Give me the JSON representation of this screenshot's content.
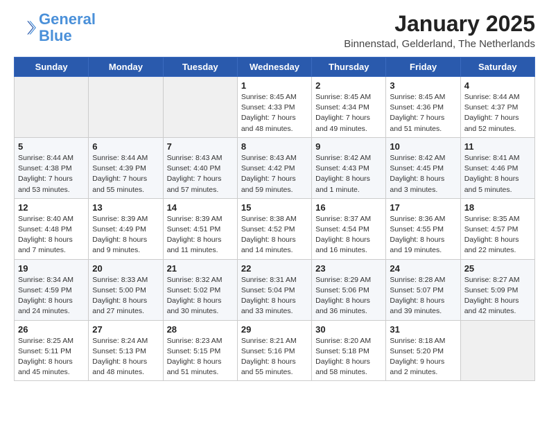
{
  "header": {
    "logo_line1": "General",
    "logo_line2": "Blue",
    "month": "January 2025",
    "location": "Binnenstad, Gelderland, The Netherlands"
  },
  "days_of_week": [
    "Sunday",
    "Monday",
    "Tuesday",
    "Wednesday",
    "Thursday",
    "Friday",
    "Saturday"
  ],
  "weeks": [
    [
      {
        "day": "",
        "info": ""
      },
      {
        "day": "",
        "info": ""
      },
      {
        "day": "",
        "info": ""
      },
      {
        "day": "1",
        "info": "Sunrise: 8:45 AM\nSunset: 4:33 PM\nDaylight: 7 hours\nand 48 minutes."
      },
      {
        "day": "2",
        "info": "Sunrise: 8:45 AM\nSunset: 4:34 PM\nDaylight: 7 hours\nand 49 minutes."
      },
      {
        "day": "3",
        "info": "Sunrise: 8:45 AM\nSunset: 4:36 PM\nDaylight: 7 hours\nand 51 minutes."
      },
      {
        "day": "4",
        "info": "Sunrise: 8:44 AM\nSunset: 4:37 PM\nDaylight: 7 hours\nand 52 minutes."
      }
    ],
    [
      {
        "day": "5",
        "info": "Sunrise: 8:44 AM\nSunset: 4:38 PM\nDaylight: 7 hours\nand 53 minutes."
      },
      {
        "day": "6",
        "info": "Sunrise: 8:44 AM\nSunset: 4:39 PM\nDaylight: 7 hours\nand 55 minutes."
      },
      {
        "day": "7",
        "info": "Sunrise: 8:43 AM\nSunset: 4:40 PM\nDaylight: 7 hours\nand 57 minutes."
      },
      {
        "day": "8",
        "info": "Sunrise: 8:43 AM\nSunset: 4:42 PM\nDaylight: 7 hours\nand 59 minutes."
      },
      {
        "day": "9",
        "info": "Sunrise: 8:42 AM\nSunset: 4:43 PM\nDaylight: 8 hours\nand 1 minute."
      },
      {
        "day": "10",
        "info": "Sunrise: 8:42 AM\nSunset: 4:45 PM\nDaylight: 8 hours\nand 3 minutes."
      },
      {
        "day": "11",
        "info": "Sunrise: 8:41 AM\nSunset: 4:46 PM\nDaylight: 8 hours\nand 5 minutes."
      }
    ],
    [
      {
        "day": "12",
        "info": "Sunrise: 8:40 AM\nSunset: 4:48 PM\nDaylight: 8 hours\nand 7 minutes."
      },
      {
        "day": "13",
        "info": "Sunrise: 8:39 AM\nSunset: 4:49 PM\nDaylight: 8 hours\nand 9 minutes."
      },
      {
        "day": "14",
        "info": "Sunrise: 8:39 AM\nSunset: 4:51 PM\nDaylight: 8 hours\nand 11 minutes."
      },
      {
        "day": "15",
        "info": "Sunrise: 8:38 AM\nSunset: 4:52 PM\nDaylight: 8 hours\nand 14 minutes."
      },
      {
        "day": "16",
        "info": "Sunrise: 8:37 AM\nSunset: 4:54 PM\nDaylight: 8 hours\nand 16 minutes."
      },
      {
        "day": "17",
        "info": "Sunrise: 8:36 AM\nSunset: 4:55 PM\nDaylight: 8 hours\nand 19 minutes."
      },
      {
        "day": "18",
        "info": "Sunrise: 8:35 AM\nSunset: 4:57 PM\nDaylight: 8 hours\nand 22 minutes."
      }
    ],
    [
      {
        "day": "19",
        "info": "Sunrise: 8:34 AM\nSunset: 4:59 PM\nDaylight: 8 hours\nand 24 minutes."
      },
      {
        "day": "20",
        "info": "Sunrise: 8:33 AM\nSunset: 5:00 PM\nDaylight: 8 hours\nand 27 minutes."
      },
      {
        "day": "21",
        "info": "Sunrise: 8:32 AM\nSunset: 5:02 PM\nDaylight: 8 hours\nand 30 minutes."
      },
      {
        "day": "22",
        "info": "Sunrise: 8:31 AM\nSunset: 5:04 PM\nDaylight: 8 hours\nand 33 minutes."
      },
      {
        "day": "23",
        "info": "Sunrise: 8:29 AM\nSunset: 5:06 PM\nDaylight: 8 hours\nand 36 minutes."
      },
      {
        "day": "24",
        "info": "Sunrise: 8:28 AM\nSunset: 5:07 PM\nDaylight: 8 hours\nand 39 minutes."
      },
      {
        "day": "25",
        "info": "Sunrise: 8:27 AM\nSunset: 5:09 PM\nDaylight: 8 hours\nand 42 minutes."
      }
    ],
    [
      {
        "day": "26",
        "info": "Sunrise: 8:25 AM\nSunset: 5:11 PM\nDaylight: 8 hours\nand 45 minutes."
      },
      {
        "day": "27",
        "info": "Sunrise: 8:24 AM\nSunset: 5:13 PM\nDaylight: 8 hours\nand 48 minutes."
      },
      {
        "day": "28",
        "info": "Sunrise: 8:23 AM\nSunset: 5:15 PM\nDaylight: 8 hours\nand 51 minutes."
      },
      {
        "day": "29",
        "info": "Sunrise: 8:21 AM\nSunset: 5:16 PM\nDaylight: 8 hours\nand 55 minutes."
      },
      {
        "day": "30",
        "info": "Sunrise: 8:20 AM\nSunset: 5:18 PM\nDaylight: 8 hours\nand 58 minutes."
      },
      {
        "day": "31",
        "info": "Sunrise: 8:18 AM\nSunset: 5:20 PM\nDaylight: 9 hours\nand 2 minutes."
      },
      {
        "day": "",
        "info": ""
      }
    ]
  ]
}
